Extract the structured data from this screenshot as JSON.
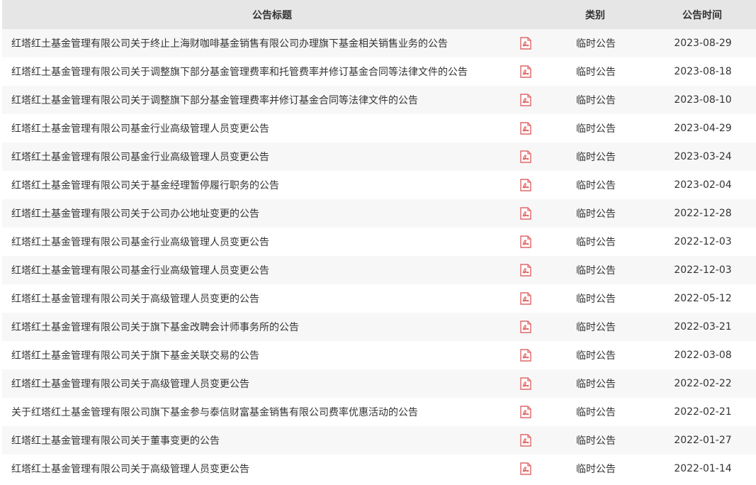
{
  "header": {
    "title_col": "公告标题",
    "type_col": "类别",
    "date_col": "公告时间"
  },
  "accent_color": "#e06666",
  "rows": [
    {
      "title": "红塔红土基金管理有限公司关于终止上海财咖啡基金销售有限公司办理旗下基金相关销售业务的公告",
      "icon": "pdf-icon",
      "type": "临时公告",
      "date": "2023-08-29"
    },
    {
      "title": "红塔红土基金管理有限公司关于调整旗下部分基金管理费率和托管费率并修订基金合同等法律文件的公告",
      "icon": "pdf-icon",
      "type": "临时公告",
      "date": "2023-08-18"
    },
    {
      "title": "红塔红土基金管理有限公司关于调整旗下部分基金管理费率并修订基金合同等法律文件的公告",
      "icon": "pdf-icon",
      "type": "临时公告",
      "date": "2023-08-10"
    },
    {
      "title": "红塔红土基金管理有限公司基金行业高级管理人员变更公告",
      "icon": "pdf-icon",
      "type": "临时公告",
      "date": "2023-04-29"
    },
    {
      "title": "红塔红土基金管理有限公司基金行业高级管理人员变更公告",
      "icon": "pdf-icon",
      "type": "临时公告",
      "date": "2023-03-24"
    },
    {
      "title": "红塔红土基金管理有限公司关于基金经理暂停履行职务的公告",
      "icon": "pdf-icon",
      "type": "临时公告",
      "date": "2023-02-04"
    },
    {
      "title": "红塔红土基金管理有限公司关于公司办公地址变更的公告",
      "icon": "pdf-icon",
      "type": "临时公告",
      "date": "2022-12-28"
    },
    {
      "title": "红塔红土基金管理有限公司基金行业高级管理人员变更公告",
      "icon": "pdf-icon",
      "type": "临时公告",
      "date": "2022-12-03"
    },
    {
      "title": "红塔红土基金管理有限公司基金行业高级管理人员变更公告",
      "icon": "pdf-icon",
      "type": "临时公告",
      "date": "2022-12-03"
    },
    {
      "title": "红塔红土基金管理有限公司关于高级管理人员变更的公告",
      "icon": "pdf-icon",
      "type": "临时公告",
      "date": "2022-05-12"
    },
    {
      "title": "红塔红土基金管理有限公司关于旗下基金改聘会计师事务所的公告",
      "icon": "pdf-icon",
      "type": "临时公告",
      "date": "2022-03-21"
    },
    {
      "title": "红塔红土基金管理有限公司关于旗下基金关联交易的公告",
      "icon": "pdf-icon",
      "type": "临时公告",
      "date": "2022-03-08"
    },
    {
      "title": "红塔红土基金管理有限公司关于高级管理人员变更公告",
      "icon": "pdf-icon",
      "type": "临时公告",
      "date": "2022-02-22"
    },
    {
      "title": "关于红塔红土基金管理有限公司旗下基金参与泰信财富基金销售有限公司费率优惠活动的公告",
      "icon": "pdf-icon",
      "type": "临时公告",
      "date": "2022-02-21"
    },
    {
      "title": "红塔红土基金管理有限公司关于董事变更的公告",
      "icon": "pdf-icon",
      "type": "临时公告",
      "date": "2022-01-27"
    },
    {
      "title": "红塔红土基金管理有限公司关于高级管理人员变更公告",
      "icon": "pdf-icon",
      "type": "临时公告",
      "date": "2022-01-14"
    }
  ]
}
